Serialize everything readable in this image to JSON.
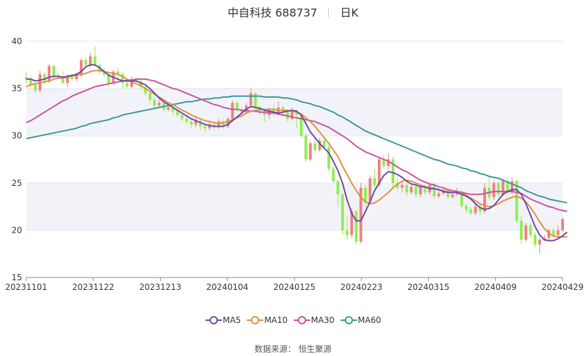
{
  "title": {
    "name": "中自科技 688737",
    "period": "日K"
  },
  "source": "数据来源： 恒生聚源",
  "chart_data": {
    "type": "candlestick",
    "ylim": [
      15,
      40
    ],
    "yticks": [
      15,
      20,
      25,
      30,
      35,
      40
    ],
    "xtick_labels": [
      "20231101",
      "20231122",
      "20231213",
      "20240104",
      "20240125",
      "20240223",
      "20240315",
      "20240409",
      "20240429"
    ],
    "colors": {
      "up": "#f08080",
      "down": "#90ee50",
      "MA5": "#6a4aa8",
      "MA10": "#e09040",
      "MA30": "#d050a0",
      "MA60": "#3a9898"
    },
    "legend": [
      "MA5",
      "MA10",
      "MA30",
      "MA60"
    ],
    "candles": [
      [
        36.2,
        36.0,
        36.8,
        35.5
      ],
      [
        36.0,
        35.4,
        36.3,
        35.0
      ],
      [
        35.4,
        34.8,
        35.6,
        34.5
      ],
      [
        34.8,
        36.5,
        36.9,
        34.6
      ],
      [
        36.5,
        35.8,
        36.7,
        35.5
      ],
      [
        35.8,
        37.4,
        37.6,
        35.6
      ],
      [
        37.4,
        36.2,
        37.5,
        36.0
      ],
      [
        36.2,
        36.3,
        36.6,
        36.0
      ],
      [
        36.3,
        35.6,
        36.8,
        35.5
      ],
      [
        35.6,
        36.2,
        36.5,
        35.2
      ],
      [
        36.2,
        36.0,
        36.4,
        35.8
      ],
      [
        36.0,
        36.4,
        36.7,
        35.8
      ],
      [
        36.4,
        38.0,
        38.2,
        36.2
      ],
      [
        38.0,
        37.5,
        38.3,
        37.2
      ],
      [
        37.5,
        38.4,
        38.8,
        37.2
      ],
      [
        38.4,
        37.5,
        39.5,
        37.3
      ],
      [
        37.5,
        36.8,
        37.6,
        36.5
      ],
      [
        36.8,
        36.5,
        37.2,
        36.2
      ],
      [
        36.5,
        35.6,
        36.8,
        35.2
      ],
      [
        35.6,
        36.8,
        37.0,
        35.4
      ],
      [
        36.8,
        36.5,
        37.2,
        36.0
      ],
      [
        36.5,
        35.6,
        36.8,
        35.0
      ],
      [
        35.6,
        35.2,
        35.8,
        35.0
      ],
      [
        35.2,
        36.0,
        36.3,
        35.0
      ],
      [
        36.0,
        35.8,
        36.2,
        35.5
      ],
      [
        35.8,
        35.2,
        36.0,
        34.8
      ],
      [
        35.2,
        34.5,
        35.4,
        34.2
      ],
      [
        34.5,
        33.8,
        34.6,
        33.5
      ],
      [
        33.8,
        33.2,
        34.0,
        33.0
      ],
      [
        33.2,
        33.5,
        33.8,
        33.0
      ],
      [
        33.5,
        32.8,
        33.6,
        32.5
      ],
      [
        32.8,
        33.0,
        33.4,
        32.6
      ],
      [
        33.0,
        32.6,
        33.2,
        32.2
      ],
      [
        32.6,
        32.2,
        32.8,
        32.0
      ],
      [
        32.2,
        31.8,
        32.5,
        31.5
      ],
      [
        31.8,
        31.5,
        32.0,
        31.2
      ],
      [
        31.5,
        31.2,
        31.8,
        30.8
      ],
      [
        31.2,
        31.6,
        31.9,
        30.9
      ],
      [
        31.6,
        31.0,
        31.8,
        30.6
      ],
      [
        31.0,
        30.8,
        31.2,
        30.4
      ],
      [
        30.8,
        31.2,
        31.5,
        30.6
      ],
      [
        31.2,
        30.9,
        31.4,
        30.6
      ],
      [
        30.9,
        31.5,
        31.8,
        30.7
      ],
      [
        31.5,
        31.0,
        31.7,
        30.8
      ],
      [
        31.0,
        31.8,
        32.0,
        30.8
      ],
      [
        31.8,
        33.5,
        33.8,
        31.6
      ],
      [
        33.5,
        32.8,
        33.6,
        32.5
      ],
      [
        32.8,
        32.5,
        33.0,
        32.2
      ],
      [
        32.5,
        33.2,
        33.5,
        32.3
      ],
      [
        33.2,
        34.5,
        35.0,
        33.0
      ],
      [
        34.5,
        33.0,
        34.6,
        32.8
      ],
      [
        33.0,
        32.6,
        33.2,
        32.2
      ],
      [
        32.6,
        32.2,
        32.9,
        31.5
      ],
      [
        32.2,
        32.8,
        33.0,
        31.8
      ],
      [
        32.8,
        32.4,
        33.4,
        32.0
      ],
      [
        32.4,
        33.0,
        33.6,
        32.2
      ],
      [
        33.0,
        32.5,
        33.2,
        32.0
      ],
      [
        32.5,
        31.8,
        32.8,
        31.5
      ],
      [
        31.8,
        32.6,
        33.0,
        31.6
      ],
      [
        32.6,
        32.2,
        32.8,
        30.8
      ],
      [
        32.2,
        30.0,
        32.4,
        29.8
      ],
      [
        30.0,
        27.5,
        30.2,
        27.2
      ],
      [
        27.5,
        29.2,
        29.5,
        27.3
      ],
      [
        29.2,
        28.5,
        29.6,
        28.2
      ],
      [
        28.5,
        29.5,
        29.8,
        28.3
      ],
      [
        29.5,
        28.8,
        30.0,
        28.6
      ],
      [
        28.8,
        26.5,
        29.0,
        26.2
      ],
      [
        26.5,
        25.2,
        26.8,
        25.0
      ],
      [
        25.2,
        23.8,
        25.4,
        22.5
      ],
      [
        23.8,
        20.0,
        24.0,
        19.5
      ],
      [
        20.0,
        19.5,
        21.5,
        19.0
      ],
      [
        19.5,
        22.0,
        22.4,
        19.2
      ],
      [
        22.0,
        18.8,
        22.2,
        18.5
      ],
      [
        18.8,
        24.5,
        25.0,
        18.6
      ],
      [
        24.5,
        23.0,
        24.8,
        22.4
      ],
      [
        23.0,
        25.5,
        25.8,
        22.8
      ],
      [
        25.5,
        24.8,
        26.5,
        24.5
      ],
      [
        24.8,
        27.5,
        27.8,
        24.6
      ],
      [
        27.5,
        26.8,
        28.0,
        26.5
      ],
      [
        26.8,
        27.5,
        28.2,
        26.4
      ],
      [
        27.5,
        25.0,
        27.8,
        24.5
      ],
      [
        25.0,
        24.5,
        25.6,
        24.2
      ],
      [
        24.5,
        24.8,
        25.2,
        24.0
      ],
      [
        24.8,
        24.0,
        25.0,
        23.6
      ],
      [
        24.0,
        24.6,
        24.9,
        23.8
      ],
      [
        24.6,
        23.8,
        24.8,
        23.4
      ],
      [
        23.8,
        24.5,
        24.7,
        23.5
      ],
      [
        24.5,
        24.0,
        24.8,
        23.7
      ],
      [
        24.0,
        24.8,
        25.1,
        23.8
      ],
      [
        24.8,
        23.6,
        25.0,
        23.3
      ],
      [
        23.6,
        23.9,
        24.2,
        23.4
      ],
      [
        23.9,
        24.2,
        24.5,
        23.7
      ],
      [
        24.2,
        23.5,
        24.4,
        23.3
      ],
      [
        23.5,
        23.8,
        24.1,
        23.4
      ],
      [
        23.8,
        24.1,
        24.5,
        23.6
      ],
      [
        24.1,
        22.6,
        24.3,
        22.3
      ],
      [
        22.6,
        22.2,
        22.8,
        21.8
      ],
      [
        22.2,
        21.8,
        22.5,
        21.6
      ],
      [
        21.8,
        22.5,
        22.8,
        21.6
      ],
      [
        22.5,
        22.0,
        22.7,
        21.6
      ],
      [
        22.0,
        24.5,
        25.0,
        21.8
      ],
      [
        24.5,
        23.5,
        25.8,
        23.2
      ],
      [
        23.5,
        25.0,
        25.3,
        23.2
      ],
      [
        25.0,
        23.8,
        25.2,
        23.5
      ],
      [
        23.8,
        25.2,
        25.5,
        23.6
      ],
      [
        25.2,
        24.0,
        25.6,
        23.8
      ],
      [
        24.0,
        25.2,
        25.6,
        23.8
      ],
      [
        25.2,
        21.0,
        25.4,
        20.8
      ],
      [
        21.0,
        19.0,
        21.5,
        18.5
      ],
      [
        19.0,
        20.5,
        20.8,
        18.8
      ],
      [
        20.5,
        19.5,
        20.8,
        19.2
      ],
      [
        19.5,
        18.5,
        19.8,
        18.2
      ],
      [
        18.5,
        19.0,
        19.2,
        17.5
      ],
      [
        19.0,
        19.2,
        19.5,
        18.8
      ],
      [
        19.2,
        20.0,
        20.2,
        19.0
      ],
      [
        20.0,
        19.5,
        20.3,
        19.2
      ],
      [
        19.5,
        20.0,
        20.5,
        19.3
      ],
      [
        20.0,
        21.2,
        21.3,
        19.8
      ]
    ],
    "ma": {
      "MA5": [
        36.0,
        36.0,
        35.8,
        35.9,
        36.0,
        36.2,
        36.3,
        36.3,
        36.2,
        36.3,
        36.4,
        36.5,
        36.8,
        37.3,
        37.5,
        37.5,
        37.2,
        36.8,
        36.4,
        36.2,
        36.0,
        35.8,
        35.8,
        35.8,
        35.8,
        35.6,
        35.4,
        35.0,
        34.5,
        34.0,
        33.6,
        33.3,
        33.0,
        32.7,
        32.4,
        32.1,
        31.8,
        31.6,
        31.4,
        31.2,
        31.1,
        31.0,
        31.0,
        31.0,
        31.2,
        31.6,
        32.0,
        32.4,
        32.8,
        33.1,
        33.0,
        32.9,
        32.7,
        32.6,
        32.5,
        32.4,
        32.5,
        32.6,
        32.7,
        32.6,
        32.2,
        31.3,
        30.4,
        29.8,
        29.2,
        28.7,
        28.2,
        27.3,
        26.3,
        25.0,
        23.2,
        21.8,
        21.0,
        21.0,
        22.0,
        23.0,
        24.2,
        25.0,
        25.8,
        26.2,
        26.1,
        25.9,
        25.6,
        25.2,
        24.9,
        24.8,
        24.6,
        24.6,
        24.4,
        24.4,
        24.3,
        24.1,
        24.0,
        24.0,
        24.0,
        23.8,
        23.6,
        23.3,
        22.8,
        22.4,
        22.2,
        22.3,
        22.6,
        23.2,
        23.8,
        24.1,
        24.3,
        24.3,
        23.8,
        22.8,
        21.6,
        20.4,
        19.5,
        19.0,
        18.9,
        18.9,
        19.1,
        19.4,
        19.8
      ],
      "MA10": [
        35.2,
        35.4,
        35.5,
        35.6,
        35.7,
        35.8,
        36.0,
        36.1,
        36.1,
        36.2,
        36.3,
        36.4,
        36.5,
        36.6,
        36.8,
        36.9,
        36.9,
        36.8,
        36.7,
        36.6,
        36.5,
        36.3,
        36.0,
        35.7,
        35.5,
        35.3,
        35.0,
        34.7,
        34.4,
        34.1,
        33.8,
        33.5,
        33.3,
        33.0,
        32.7,
        32.5,
        32.2,
        32.0,
        31.8,
        31.6,
        31.5,
        31.4,
        31.3,
        31.4,
        31.5,
        31.7,
        31.9,
        32.1,
        32.4,
        32.6,
        32.7,
        32.8,
        32.8,
        32.8,
        32.8,
        32.7,
        32.7,
        32.7,
        32.6,
        32.5,
        32.3,
        31.9,
        31.5,
        31.0,
        30.4,
        29.8,
        29.2,
        28.5,
        27.8,
        26.8,
        25.9,
        25.0,
        24.2,
        23.5,
        23.0,
        22.8,
        22.9,
        23.2,
        23.6,
        24.0,
        24.5,
        24.9,
        25.2,
        25.3,
        25.2,
        25.0,
        24.8,
        24.6,
        24.5,
        24.4,
        24.3,
        24.2,
        24.1,
        24.0,
        24.0,
        23.9,
        23.7,
        23.4,
        23.1,
        22.8,
        22.6,
        22.5,
        22.6,
        22.8,
        23.1,
        23.3,
        23.5,
        23.6,
        23.4,
        23.0,
        22.4,
        21.7,
        20.9,
        20.2,
        19.7,
        19.4,
        19.3,
        19.3,
        19.3
      ],
      "MA30": [
        31.4,
        31.6,
        31.9,
        32.2,
        32.5,
        32.8,
        33.1,
        33.4,
        33.7,
        33.9,
        34.2,
        34.4,
        34.6,
        34.8,
        35.0,
        35.2,
        35.3,
        35.4,
        35.5,
        35.6,
        35.7,
        35.8,
        35.9,
        35.9,
        36.0,
        36.0,
        36.0,
        35.9,
        35.8,
        35.6,
        35.4,
        35.2,
        35.0,
        34.9,
        34.7,
        34.5,
        34.3,
        34.1,
        33.9,
        33.7,
        33.5,
        33.3,
        33.2,
        33.0,
        32.9,
        32.8,
        32.8,
        32.7,
        32.7,
        32.6,
        32.6,
        32.5,
        32.5,
        32.4,
        32.4,
        32.3,
        32.2,
        32.1,
        32.0,
        31.9,
        31.8,
        31.7,
        31.6,
        31.5,
        31.3,
        31.1,
        30.9,
        30.6,
        30.3,
        30.0,
        29.7,
        29.3,
        28.9,
        28.6,
        28.3,
        28.1,
        27.9,
        27.7,
        27.5,
        27.3,
        27.0,
        26.7,
        26.4,
        26.2,
        25.9,
        25.6,
        25.3,
        25.1,
        24.9,
        24.8,
        24.6,
        24.5,
        24.3,
        24.2,
        24.1,
        24.0,
        23.9,
        23.8,
        23.8,
        23.8,
        23.9,
        24.0,
        24.1,
        24.1,
        24.1,
        24.1,
        24.1,
        24.0,
        23.9,
        23.6,
        23.3,
        23.1,
        22.9,
        22.7,
        22.5,
        22.4,
        22.2,
        22.1,
        22.0
      ],
      "MA60": [
        29.7,
        29.8,
        29.9,
        30.0,
        30.1,
        30.2,
        30.3,
        30.4,
        30.5,
        30.6,
        30.7,
        30.8,
        31.0,
        31.1,
        31.3,
        31.4,
        31.5,
        31.6,
        31.7,
        31.9,
        32.0,
        32.2,
        32.3,
        32.4,
        32.5,
        32.6,
        32.7,
        32.8,
        32.9,
        33.0,
        33.1,
        33.2,
        33.3,
        33.4,
        33.5,
        33.6,
        33.6,
        33.7,
        33.8,
        33.9,
        33.9,
        34.0,
        34.0,
        34.1,
        34.1,
        34.2,
        34.2,
        34.2,
        34.2,
        34.2,
        34.2,
        34.2,
        34.1,
        34.1,
        34.1,
        34.1,
        34.0,
        34.0,
        33.9,
        33.8,
        33.6,
        33.5,
        33.4,
        33.2,
        33.1,
        32.9,
        32.7,
        32.5,
        32.2,
        32.0,
        31.7,
        31.4,
        31.1,
        30.8,
        30.5,
        30.3,
        30.1,
        29.9,
        29.7,
        29.5,
        29.3,
        29.1,
        28.9,
        28.7,
        28.5,
        28.3,
        28.1,
        27.9,
        27.7,
        27.5,
        27.4,
        27.2,
        27.0,
        26.9,
        26.8,
        26.6,
        26.5,
        26.3,
        26.2,
        26.0,
        25.9,
        25.7,
        25.6,
        25.5,
        25.3,
        25.1,
        24.9,
        24.7,
        24.5,
        24.2,
        24.0,
        23.8,
        23.6,
        23.5,
        23.3,
        23.2,
        23.1,
        23.0,
        22.9
      ]
    }
  }
}
